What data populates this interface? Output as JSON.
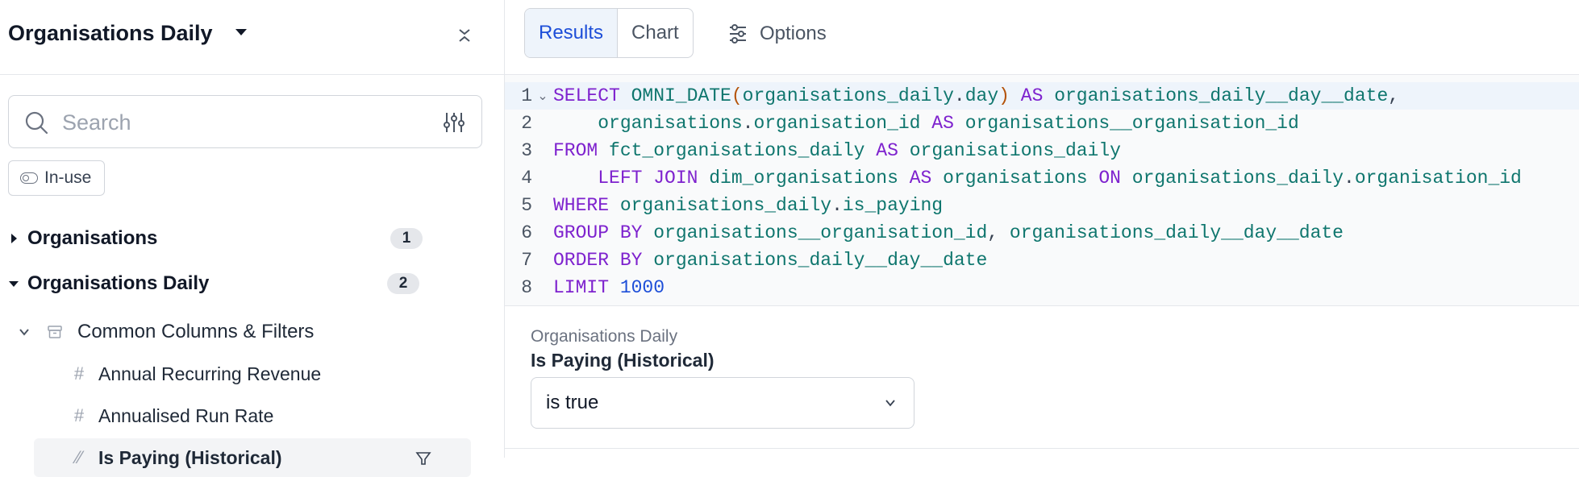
{
  "sidebar": {
    "title": "Organisations Daily",
    "search": {
      "placeholder": "Search",
      "value": ""
    },
    "inuse_label": "In-use",
    "tree": [
      {
        "label": "Organisations",
        "count": "1",
        "expanded": false
      },
      {
        "label": "Organisations Daily",
        "count": "2",
        "expanded": true
      }
    ],
    "group_label": "Common Columns & Filters",
    "fields": [
      {
        "label": "Annual Recurring Revenue",
        "icon": "#"
      },
      {
        "label": "Annualised Run Rate",
        "icon": "#"
      },
      {
        "label": "Is Paying (Historical)",
        "icon": "boolean-icon",
        "selected": true
      }
    ]
  },
  "toolbar": {
    "tabs": [
      {
        "label": "Results",
        "active": true
      },
      {
        "label": "Chart",
        "active": false
      }
    ],
    "options_label": "Options"
  },
  "editor": {
    "lines": [
      {
        "num": "1"
      },
      {
        "num": "2"
      },
      {
        "num": "3"
      },
      {
        "num": "4"
      },
      {
        "num": "5"
      },
      {
        "num": "6"
      },
      {
        "num": "7"
      },
      {
        "num": "8"
      }
    ],
    "tokens": {
      "l1": [
        "SELECT",
        " OMNI_DATE",
        "(",
        "organisations_daily",
        ".",
        "day",
        ")",
        " AS",
        " organisations_daily__day__date",
        ","
      ],
      "l2": [
        "    organisations",
        ".",
        "organisation_id",
        " AS",
        " organisations__organisation_id"
      ],
      "l3": [
        "FROM",
        " fct_organisations_daily",
        " AS",
        " organisations_daily"
      ],
      "l4": [
        "    LEFT JOIN",
        " dim_organisations",
        " AS",
        " organisations",
        " ON",
        " organisations_daily",
        ".",
        "organisation_id"
      ],
      "l5": [
        "WHERE",
        " organisations_daily",
        ".",
        "is_paying"
      ],
      "l6": [
        "GROUP BY",
        " organisations__organisation_id",
        ",",
        " organisations_daily__day__date"
      ],
      "l7": [
        "ORDER BY",
        " organisations_daily__day__date"
      ],
      "l8": [
        "LIMIT",
        " 1000"
      ]
    }
  },
  "filter": {
    "subtitle": "Organisations Daily",
    "title": "Is Paying (Historical)",
    "value": "is true"
  },
  "colors": {
    "keyword": "#7e22ce",
    "identifier": "#0f766e",
    "number": "#1d4ed8",
    "accent": "#1d4ed8"
  }
}
